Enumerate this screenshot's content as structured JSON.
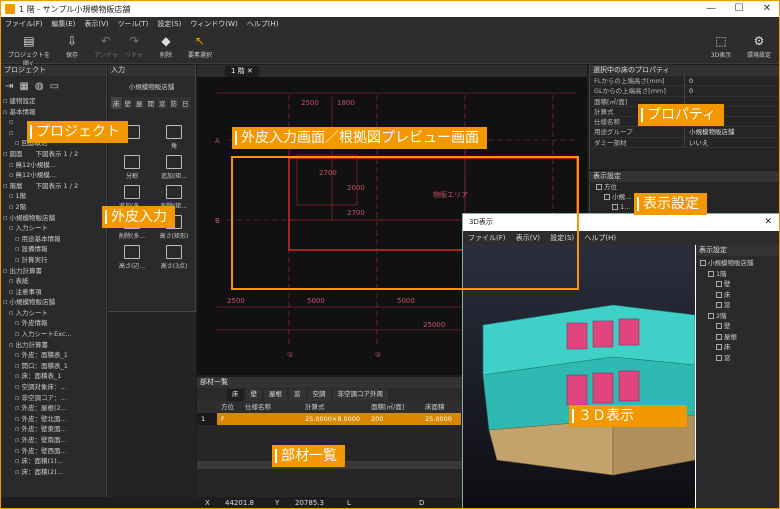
{
  "window": {
    "title": "1 階 - サンプル小規模物販店舗",
    "min": "—",
    "max": "☐",
    "close": "✕"
  },
  "menu": [
    "ファイル(F)",
    "編集(E)",
    "表示(V)",
    "ツール(T)",
    "設定(S)",
    "ウィンドウ(W)",
    "ヘルプ(H)"
  ],
  "toolbar": {
    "open": "プロジェクトを開く",
    "save": "保存",
    "undo": "アンドゥ",
    "redo": "リドゥ",
    "delete": "削除",
    "select": "要素選択",
    "view3d": "3D表示",
    "env": "環境設定"
  },
  "project_panel": {
    "title": "プロジェクト",
    "tree": [
      "建物設定",
      "基本情報",
      "",
      "",
      "回面取込",
      "図面　　下図表示 1 / 2",
      "無12小規模...",
      "無12小規模...",
      "階層　　下図表示 1 / 2",
      "1階",
      "2階",
      "小規模物販店舗",
      "入力シート",
      "用途基本情報",
      "設備情報",
      "計算実行",
      "出力計算書",
      "表紙",
      "注意事項",
      "小規模物販店舗",
      "入力シート",
      "外皮情報",
      "入力シートExc...",
      "出力計算書",
      "外皮：面積表_1",
      "開口：面積表_1",
      "床：面積表_1",
      "空調対象床：...",
      "非空調コア：...",
      "外皮：屋根(2...",
      "外皮：壁北面...",
      "外皮：壁東面...",
      "外皮：壁南面...",
      "外皮：壁西面...",
      "床：面積(1)...",
      "床：面積(2)..."
    ]
  },
  "input_panel": {
    "title": "入力",
    "building": "小規模物販店舗",
    "tabs": [
      "床",
      "壁",
      "屋",
      "開",
      "窓",
      "防",
      "日"
    ],
    "buttons": [
      "",
      "角",
      "分割",
      "追加(矩...",
      "追加(多...",
      "削除(矩...",
      "削除(多...",
      "高さ(矩形)",
      "高さ(辺...",
      "高さ(3点)"
    ]
  },
  "canvas": {
    "tab": "1 階",
    "dims": [
      "2500",
      "1800",
      "2700",
      "2000",
      "2700",
      "5000",
      "5000",
      "2500",
      "25000",
      "2500",
      "1400"
    ],
    "room": "物販エリア",
    "grid": [
      "①",
      "②",
      "③",
      "④",
      "⑤"
    ],
    "rows": [
      "A",
      "B"
    ]
  },
  "properties": {
    "title": "選択中の床のプロパティ",
    "rows": [
      {
        "k": "FLからの上端高さ[mm]",
        "v": "0"
      },
      {
        "k": "GLからの上端高さ[mm]",
        "v": "0"
      },
      {
        "k": "面積[㎡/面]",
        "v": ""
      },
      {
        "k": "計算式",
        "v": ""
      },
      {
        "k": "仕様名称",
        "v": ""
      },
      {
        "k": "用途グループ",
        "v": "小規模物販店舗"
      },
      {
        "k": "ダミー部材",
        "v": "いいえ"
      }
    ]
  },
  "display": {
    "title": "表示設定",
    "items": [
      "方位",
      "小規...",
      "1..."
    ]
  },
  "member_list": {
    "title": "部材一覧",
    "tabs": [
      "床",
      "壁",
      "屋根",
      "窓",
      "空調",
      "非空調コア外周"
    ],
    "headers": [
      "",
      "方位",
      "仕様名称",
      "計算式",
      "面積[㎡/面]",
      "床面積"
    ],
    "row": [
      "1",
      "F",
      "",
      "25.0000×8.0000",
      "200",
      "25.0000"
    ]
  },
  "status": {
    "x_label": "X",
    "x": "44201.8",
    "y_label": "Y",
    "y": "20785.3",
    "l": "L",
    "d": "D"
  },
  "window3d": {
    "title": "3D表示",
    "menu": [
      "ファイル(F)",
      "表示(V)",
      "設定(S)",
      "ヘルプ(H)"
    ],
    "panel_title": "表示設定",
    "tree": [
      "小規模物販店舗",
      "1階",
      "壁",
      "床",
      "窓",
      "2階",
      "壁",
      "屋根",
      "床",
      "窓"
    ]
  },
  "callouts": {
    "project": "プロジェクト",
    "input": "外皮入力",
    "canvas": "外皮入力画面／根拠図プレビュー画面",
    "properties": "プロパティ",
    "display": "表示設定",
    "view3d": "３Ｄ表示",
    "list": "部材一覧"
  },
  "colors": {
    "accent": "#f39800",
    "floor_line": "#d1262b",
    "wall_cyan": "#2ec4c2",
    "window_pink": "#e0457f"
  }
}
